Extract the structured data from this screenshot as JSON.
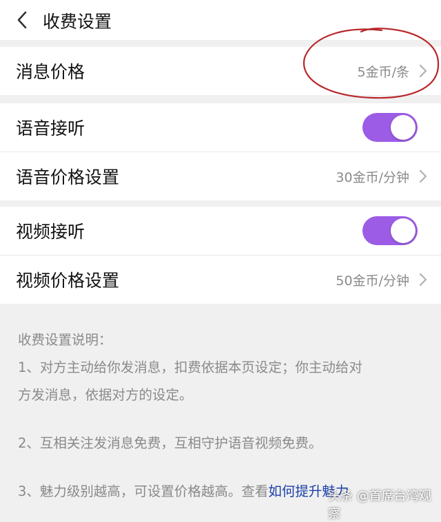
{
  "header": {
    "title": "收费设置"
  },
  "settings": {
    "message_price": {
      "label": "消息价格",
      "value": "5金币/条"
    },
    "voice_answer": {
      "label": "语音接听",
      "enabled": true
    },
    "voice_price": {
      "label": "语音价格设置",
      "value": "30金币/分钟"
    },
    "video_answer": {
      "label": "视频接听",
      "enabled": true
    },
    "video_price": {
      "label": "视频价格设置",
      "value": "50金币/分钟"
    }
  },
  "notes": {
    "heading": "收费设置说明：",
    "item1_line1": "1、对方主动给你发消息，扣费依据本页设定；你主动给对",
    "item1_line2": "方发消息，依据对方的设定。",
    "item2": "2、互相关注发消息免费，互相守护语音视频免费。",
    "item3_text": "3、魅力级别越高，可设置价格越高。查看",
    "item3_link": "如何提升魅力"
  },
  "watermark": "头条 @首席台湾观察",
  "colors": {
    "toggle_on": "#9c5ce6",
    "annotation_circle": "#b8262a",
    "link": "#1a3fa8"
  },
  "icons": {
    "back": "chevron-left-icon",
    "row_arrow": "chevron-right-icon"
  }
}
